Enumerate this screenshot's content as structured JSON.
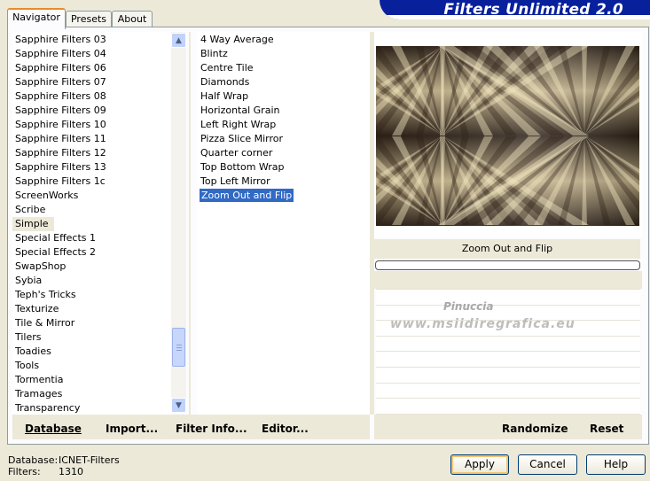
{
  "tabs": [
    "Navigator",
    "Presets",
    "About"
  ],
  "app_title": "Filters Unlimited 2.0",
  "categories": [
    "Sapphire Filters 03",
    "Sapphire Filters 04",
    "Sapphire Filters 06",
    "Sapphire Filters 07",
    "Sapphire Filters 08",
    "Sapphire Filters 09",
    "Sapphire Filters 10",
    "Sapphire Filters 11",
    "Sapphire Filters 12",
    "Sapphire Filters 13",
    "Sapphire Filters 1c",
    "ScreenWorks",
    "Scribe",
    "Simple",
    "Special Effects 1",
    "Special Effects 2",
    "SwapShop",
    "Sybia",
    "Teph's Tricks",
    "Texturize",
    "Tile & Mirror",
    "Tilers",
    "Toadies",
    "Tools",
    "Tormentia",
    "Tramages",
    "Transparency"
  ],
  "selected_category": "Simple",
  "filters": [
    "4 Way Average",
    "Blintz",
    "Centre Tile",
    "Diamonds",
    "Half Wrap",
    "Horizontal Grain",
    "Left Right Wrap",
    "Pizza Slice Mirror",
    "Quarter corner",
    "Top Bottom Wrap",
    "Top Left Mirror",
    "Zoom Out and Flip"
  ],
  "selected_filter": "Zoom Out and Flip",
  "preview_title": "Zoom Out and Flip",
  "watermark": [
    "Pinuccia",
    "www.msiidiregrafica.eu"
  ],
  "toolbar": {
    "database": "Database",
    "import": "Import...",
    "filter_info": "Filter Info...",
    "editor": "Editor...",
    "randomize": "Randomize",
    "reset": "Reset"
  },
  "status": {
    "database_label": "Database:",
    "database_value": "ICNET-Filters",
    "filters_label": "Filters:",
    "filters_value": "1310"
  },
  "buttons": {
    "apply": "Apply",
    "cancel": "Cancel",
    "help": "Help"
  },
  "scroll_position": 0.8,
  "colors": {
    "title_bar": "#08209c",
    "selection": "#316ac5",
    "preview_dark": "#2e2218",
    "preview_light": "#e8dcb2"
  }
}
